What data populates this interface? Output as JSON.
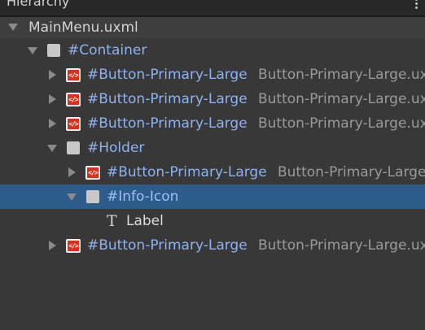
{
  "panel": {
    "title": "Hierarchy",
    "menu_icon": "kebab-menu-icon"
  },
  "colors": {
    "background": "#383838",
    "header": "#282828",
    "selection": "#2d5b8a",
    "element_name": "#8fb2f1",
    "type_name": "#9a9a9a",
    "template_icon": "#d2331f"
  },
  "tree": {
    "root": {
      "label": "MainMenu.uxml",
      "expanded": true
    },
    "container": {
      "label": "#Container",
      "expanded": true
    },
    "button1": {
      "label": "#Button-Primary-Large",
      "type": "Button-Primary-Large.uxml",
      "icon": "uxml-template-icon",
      "icon_text": "</>"
    },
    "button2": {
      "label": "#Button-Primary-Large",
      "type": "Button-Primary-Large.uxml",
      "icon": "uxml-template-icon",
      "icon_text": "</>"
    },
    "button3": {
      "label": "#Button-Primary-Large",
      "type": "Button-Primary-Large.uxml",
      "icon": "uxml-template-icon",
      "icon_text": "</>"
    },
    "holder": {
      "label": "#Holder",
      "expanded": true
    },
    "button4": {
      "label": "#Button-Primary-Large",
      "type": "Button-Primary-Large.uxml",
      "icon": "uxml-template-icon",
      "icon_text": "</>"
    },
    "info_icon": {
      "label": "#Info-Icon",
      "expanded": true,
      "selected": true
    },
    "label": {
      "label": "Label",
      "icon": "text-element-icon",
      "icon_text": "T"
    },
    "button5": {
      "label": "#Button-Primary-Large",
      "type": "Button-Primary-Large.uxml",
      "icon": "uxml-template-icon",
      "icon_text": "</>"
    }
  }
}
